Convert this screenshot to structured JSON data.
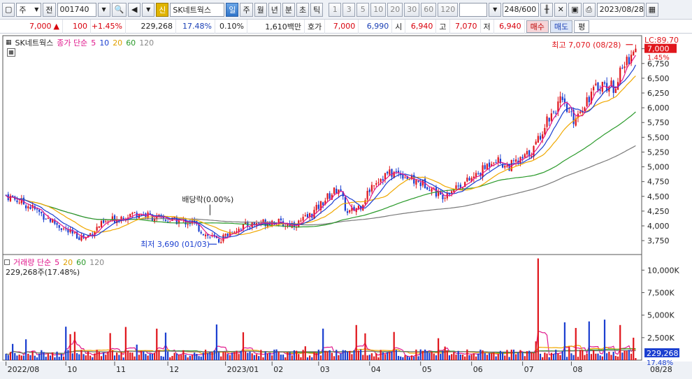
{
  "toolbar": {
    "market": "주",
    "all": "전",
    "code": "001740",
    "credit_badge": "신",
    "stock_name": "SK네트웍스",
    "periods": [
      "일",
      "주",
      "월",
      "년",
      "분",
      "초",
      "틱"
    ],
    "active_period": "일",
    "intervals": [
      "1",
      "3",
      "5",
      "10",
      "20",
      "30",
      "60",
      "120"
    ],
    "count": "248",
    "count_max": "/600",
    "date": "2023/08/28"
  },
  "info": {
    "price": "7,000",
    "change": "100",
    "change_pct": "+1.45%",
    "volume": "229,268",
    "volume_ratio": "17.48%",
    "turnover": "0.10%",
    "amount": "1,610백만",
    "quote_label": "호가",
    "ask": "7,000",
    "bid": "6,990",
    "open_label": "시",
    "open": "6,940",
    "high_label": "고",
    "high": "7,070",
    "low_label": "저",
    "low": "6,940",
    "buy_label": "매수",
    "sell_label": "매도",
    "eval_label": "평"
  },
  "price_legend": {
    "name": "SK네트웍스",
    "ma_label": "종가 단순",
    "ma": [
      "5",
      "10",
      "20",
      "60",
      "120"
    ]
  },
  "volume_legend": {
    "name": "거래량 단순",
    "ma": [
      "5",
      "20",
      "60",
      "120"
    ],
    "current": "229,268주(17.48%)"
  },
  "annotations": {
    "high": "최고 7,070 (08/28)",
    "low": "최저 3,690 (01/03)",
    "dividend": "배당락(0.00%)",
    "lc": "LC:89.70",
    "price_tag": "7,000",
    "pct_tag": "1.45%",
    "vol_tag": "229,268",
    "vol_pct_tag": "17.48%",
    "last_date": "08/28"
  },
  "colors": {
    "up": "#e0161c",
    "down": "#1b3fd0",
    "ma5": "#e0188c",
    "ma10": "#1b3fd0",
    "ma20": "#f0a800",
    "ma60": "#2a9a2a",
    "ma120": "#7a7a7a"
  },
  "chart_data": {
    "type": "candlestick",
    "price_axis": {
      "ticks": [
        "7,000",
        "6,750",
        "6,500",
        "6,250",
        "6,000",
        "5,750",
        "5,500",
        "5,250",
        "5,000",
        "4,750",
        "4,500",
        "4,250",
        "4,000",
        "3,750"
      ],
      "range": [
        3550,
        7150
      ]
    },
    "volume_axis": {
      "ticks": [
        "10,000K",
        "7,500K",
        "5,000K",
        "2,500K"
      ],
      "range": [
        0,
        11500000
      ]
    },
    "x_labels": [
      "2022/08",
      "10",
      "11",
      "12",
      "2023/01",
      "02",
      "03",
      "04",
      "05",
      "06",
      "07",
      "08"
    ],
    "close_path": [
      {
        "t": 0,
        "v": 4520
      },
      {
        "t": 6,
        "v": 4420
      },
      {
        "t": 12,
        "v": 4300
      },
      {
        "t": 18,
        "v": 4150
      },
      {
        "t": 24,
        "v": 4000
      },
      {
        "t": 30,
        "v": 3850
      },
      {
        "t": 36,
        "v": 3800
      },
      {
        "t": 42,
        "v": 4000
      },
      {
        "t": 48,
        "v": 4100
      },
      {
        "t": 54,
        "v": 4180
      },
      {
        "t": 60,
        "v": 4220
      },
      {
        "t": 66,
        "v": 4150
      },
      {
        "t": 72,
        "v": 4100
      },
      {
        "t": 78,
        "v": 4080
      },
      {
        "t": 84,
        "v": 4060
      },
      {
        "t": 90,
        "v": 3850
      },
      {
        "t": 96,
        "v": 3750
      },
      {
        "t": 102,
        "v": 3920
      },
      {
        "t": 108,
        "v": 4000
      },
      {
        "t": 114,
        "v": 4050
      },
      {
        "t": 120,
        "v": 4080
      },
      {
        "t": 126,
        "v": 4020
      },
      {
        "t": 132,
        "v": 4050
      },
      {
        "t": 138,
        "v": 4200
      },
      {
        "t": 144,
        "v": 4450
      },
      {
        "t": 150,
        "v": 4650
      },
      {
        "t": 154,
        "v": 4200
      },
      {
        "t": 160,
        "v": 4350
      },
      {
        "t": 166,
        "v": 4750
      },
      {
        "t": 172,
        "v": 4880
      },
      {
        "t": 178,
        "v": 4900
      },
      {
        "t": 184,
        "v": 4750
      },
      {
        "t": 190,
        "v": 4700
      },
      {
        "t": 196,
        "v": 4500
      },
      {
        "t": 202,
        "v": 4650
      },
      {
        "t": 208,
        "v": 4750
      },
      {
        "t": 214,
        "v": 4900
      },
      {
        "t": 220,
        "v": 5150
      },
      {
        "t": 226,
        "v": 5000
      },
      {
        "t": 232,
        "v": 5100
      },
      {
        "t": 238,
        "v": 5300
      },
      {
        "t": 244,
        "v": 5800
      },
      {
        "t": 250,
        "v": 6100
      },
      {
        "t": 256,
        "v": 5800
      },
      {
        "t": 262,
        "v": 6150
      },
      {
        "t": 268,
        "v": 6400
      },
      {
        "t": 274,
        "v": 6350
      },
      {
        "t": 280,
        "v": 6800
      },
      {
        "t": 284,
        "v": 7000
      }
    ]
  }
}
